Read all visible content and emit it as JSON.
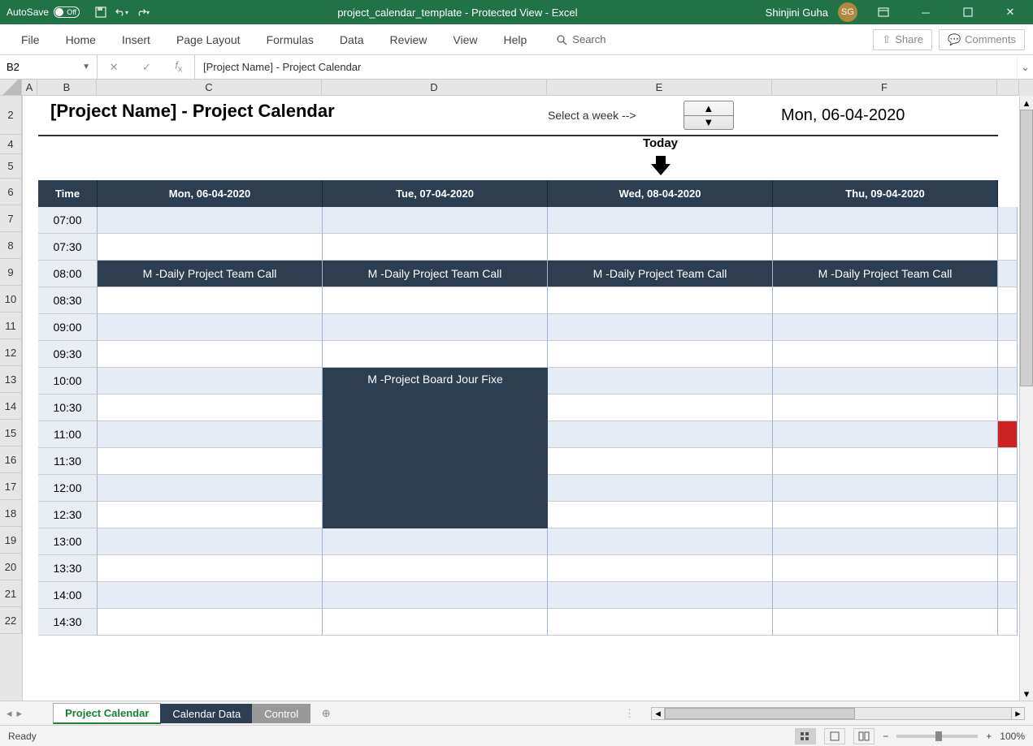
{
  "titlebar": {
    "autosave": "AutoSave",
    "autosave_state": "Off",
    "filename": "project_calendar_template  -  Protected View  -  Excel",
    "user_name": "Shinjini Guha",
    "user_initials": "SG"
  },
  "ribbon": {
    "tabs": [
      "File",
      "Home",
      "Insert",
      "Page Layout",
      "Formulas",
      "Data",
      "Review",
      "View",
      "Help"
    ],
    "search": "Search",
    "share": "Share",
    "comments": "Comments"
  },
  "formula_bar": {
    "cell_ref": "B2",
    "formula": "[Project Name] - Project Calendar"
  },
  "columns": [
    "A",
    "B",
    "C",
    "D",
    "E",
    "F"
  ],
  "rows": [
    "2",
    "4",
    "5",
    "6",
    "7",
    "8",
    "9",
    "10",
    "11",
    "12",
    "13",
    "14",
    "15",
    "16",
    "17",
    "18",
    "19",
    "20",
    "21",
    "22"
  ],
  "calendar": {
    "title": "[Project Name] - Project Calendar",
    "select_week": "Select a week -->",
    "current_date": "Mon, 06-04-2020",
    "today_label": "Today",
    "headers": [
      "Time",
      "Mon, 06-04-2020",
      "Tue, 07-04-2020",
      "Wed, 08-04-2020",
      "Thu, 09-04-2020"
    ],
    "times": [
      "07:00",
      "07:30",
      "08:00",
      "08:30",
      "09:00",
      "09:30",
      "10:00",
      "10:30",
      "11:00",
      "11:30",
      "12:00",
      "12:30",
      "13:00",
      "13:30",
      "14:00",
      "14:30"
    ],
    "events": {
      "daily_call": "M -Daily Project Team Call",
      "board_jour_fixe": "M -Project Board Jour Fixe"
    }
  },
  "sheet_tabs": [
    "Project Calendar",
    "Calendar Data",
    "Control"
  ],
  "statusbar": {
    "status": "Ready",
    "zoom": "100%"
  },
  "colors": {
    "header_bg": "#2c3e50",
    "excel_green": "#217346",
    "stripe": "#e6ecf5",
    "red": "#cc2222"
  }
}
